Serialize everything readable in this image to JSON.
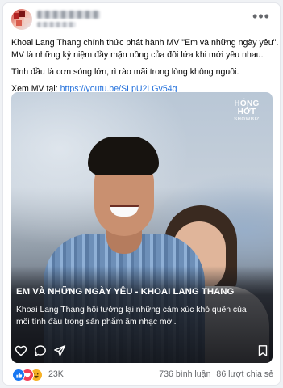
{
  "post": {
    "lines": [
      "Khoai Lang Thang chính thức phát hành MV \"Em và những ngày yêu\".",
      "MV là những kỷ niệm đầy mặn nồng của đôi lứa khi mới yêu nhau.",
      "Tình đầu là cơn sóng lớn, rì rào mãi trong lòng không nguôi."
    ],
    "link_prefix": "Xem MV tại: ",
    "link_url": "https://youtu.be/SLpU2LGv54g"
  },
  "media": {
    "logo_line1": "HÓNG",
    "logo_line2": "HỚT",
    "logo_sub": "SHOWBIZ",
    "headline": "EM VÀ NHỮNG NGÀY YÊU - KHOAI LANG THANG",
    "caption_lines": [
      "Khoai Lang Thang hồi tưởng lại những cảm xúc khó quên của",
      "mối tình đầu trong sản phẩm âm nhạc mới."
    ],
    "icons": [
      "heart-icon",
      "comment-icon",
      "share-icon",
      "bookmark-icon"
    ]
  },
  "footer": {
    "reaction_count": "23K",
    "comments": "736 bình luận",
    "shares": "86 lượt chia sẻ"
  },
  "colors": {
    "link": "#216fdb",
    "like": "#1877f2",
    "love": "#f33e58",
    "haha": "#f7b125",
    "muted_text": "#65676b"
  }
}
